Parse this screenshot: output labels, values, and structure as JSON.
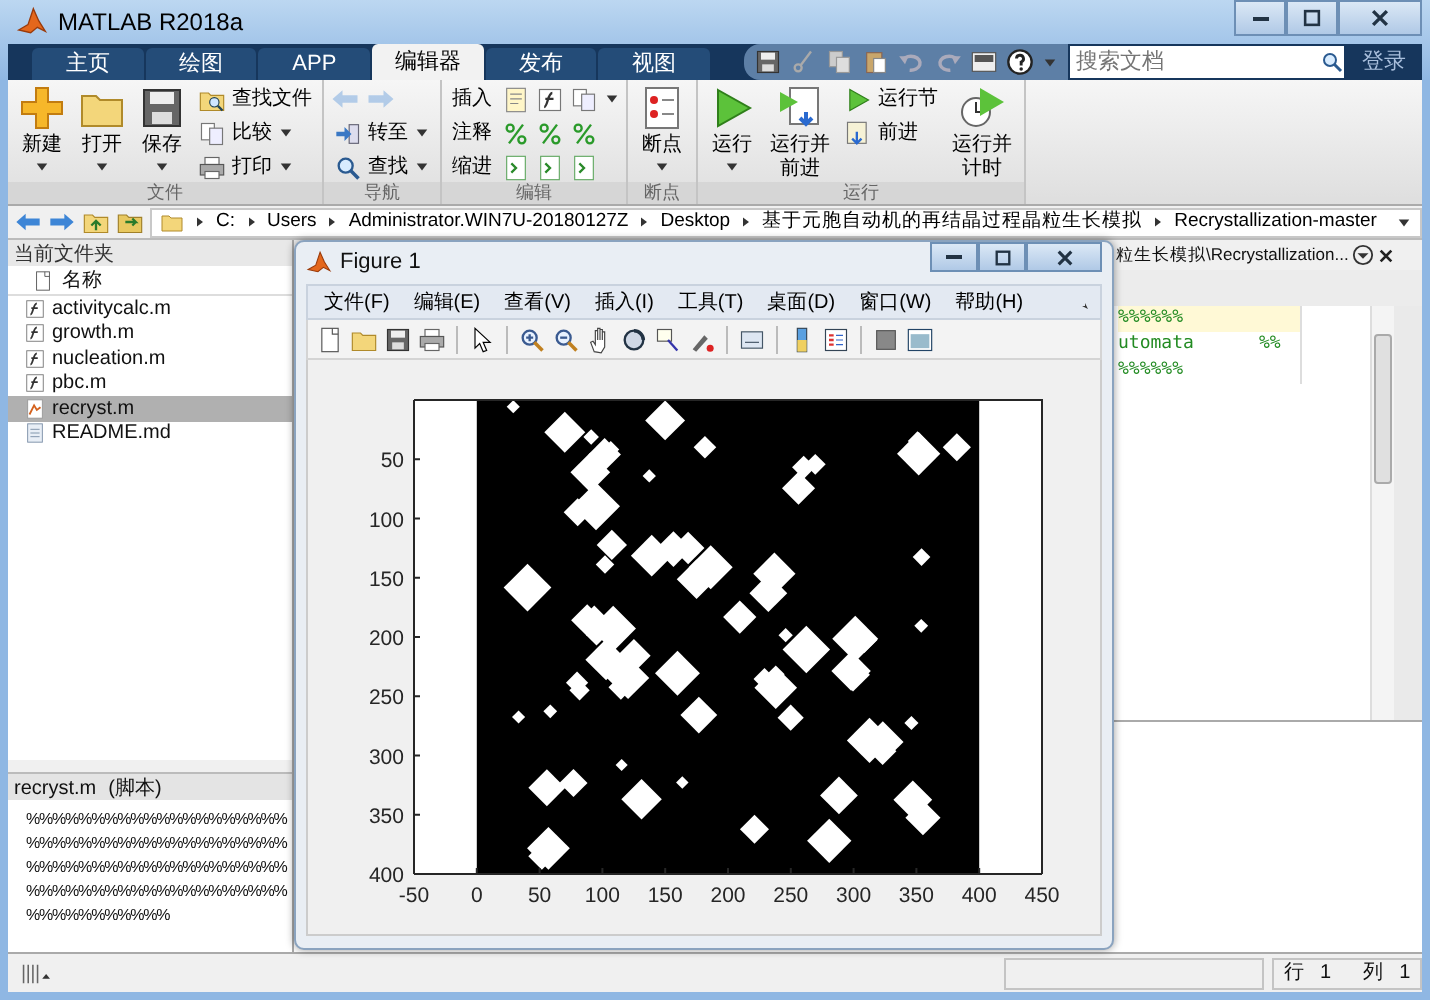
{
  "window": {
    "title": "MATLAB R2018a"
  },
  "tabs": [
    {
      "label": "主页",
      "selected": false
    },
    {
      "label": "绘图",
      "selected": false
    },
    {
      "label": "APP",
      "selected": false
    },
    {
      "label": "编辑器",
      "selected": true
    },
    {
      "label": "发布",
      "selected": false
    },
    {
      "label": "视图",
      "selected": false
    }
  ],
  "search": {
    "placeholder": "搜索文档"
  },
  "sign_in": "登录",
  "toolstrip": [
    {
      "label": "文件",
      "items": [
        {
          "kind": "large",
          "label": "新建",
          "dropdown": true
        },
        {
          "kind": "large",
          "label": "打开",
          "dropdown": true
        },
        {
          "kind": "large",
          "label": "保存",
          "dropdown": true
        },
        {
          "kind": "stack",
          "rows": [
            {
              "kind": "button",
              "label": "查找文件",
              "dropdown": false
            },
            {
              "kind": "button",
              "label": "比较",
              "dropdown": true
            },
            {
              "kind": "button",
              "label": "打印",
              "dropdown": true
            }
          ]
        }
      ]
    },
    {
      "label": "导航",
      "items": [
        {
          "kind": "stack",
          "rows": [
            {
              "kind": "arrows",
              "disabled": true
            },
            {
              "kind": "button",
              "label": "转至",
              "dropdown": true
            },
            {
              "kind": "button",
              "label": "查找",
              "dropdown": true
            }
          ]
        }
      ]
    },
    {
      "label": "编辑",
      "items": [
        {
          "kind": "stack",
          "rows": [
            {
              "kind": "tools",
              "label": "插入",
              "dropdown": true
            },
            {
              "kind": "tools",
              "label": "注释",
              "dropdown": false
            },
            {
              "kind": "tools",
              "label": "缩进",
              "dropdown": false
            }
          ]
        }
      ]
    },
    {
      "label": "断点",
      "items": [
        {
          "kind": "large",
          "label": "断点",
          "dropdown": true
        }
      ]
    },
    {
      "label": "运行",
      "items": [
        {
          "kind": "large",
          "label": "运行",
          "dropdown": true
        },
        {
          "kind": "large",
          "label": "运行并前进",
          "dropdown": false
        },
        {
          "kind": "stack",
          "rows": [
            {
              "kind": "button",
              "label": "运行节",
              "dropdown": false
            },
            {
              "kind": "button",
              "label": "前进",
              "dropdown": false
            }
          ]
        },
        {
          "kind": "large",
          "label": "运行并计时",
          "dropdown": false
        }
      ]
    }
  ],
  "address": {
    "segments": [
      "C:",
      "Users",
      "Administrator.WIN7U-20180127Z",
      "Desktop",
      "基于元胞自动机的再结晶过程晶粒生长模拟",
      "Recrystallization-master"
    ]
  },
  "current_folder": {
    "title": "当前文件夹",
    "column": "名称",
    "files": [
      {
        "name": "activitycalc.m",
        "kind": "function",
        "selected": false
      },
      {
        "name": "growth.m",
        "kind": "function",
        "selected": false
      },
      {
        "name": "nucleation.m",
        "kind": "function",
        "selected": false
      },
      {
        "name": "pbc.m",
        "kind": "function",
        "selected": false
      },
      {
        "name": "recryst.m",
        "kind": "script",
        "selected": true
      },
      {
        "name": "README.md",
        "kind": "document",
        "selected": false
      }
    ]
  },
  "details": {
    "file": "recryst.m",
    "type": "(脚本)",
    "lines": [
      "%%%%%%%%%%%%%%%%%%%%",
      "%%%%%%%%%%%%%%%%%%%%",
      "%%%%%%%%%%%%%%%%%%%%",
      "%%%%%%%%%%%%%%%%%%%%",
      "%%%%%%%%%%%"
    ]
  },
  "editor": {
    "tab_title": "粒生长模拟\\Recrystallization...",
    "lines": [
      {
        "text": "%%%%%%",
        "highlighted": true
      },
      {
        "text": "utomata      %%",
        "highlighted": false
      },
      {
        "text": "%%%%%%",
        "highlighted": false
      }
    ]
  },
  "figure": {
    "title": "Figure 1",
    "menus": [
      "文件(F)",
      "编辑(E)",
      "查看(V)",
      "插入(I)",
      "工具(T)",
      "桌面(D)",
      "窗口(W)",
      "帮助(H)"
    ],
    "xticks": [
      "-50",
      "0",
      "50",
      "100",
      "150",
      "200",
      "250",
      "300",
      "350",
      "400",
      "450"
    ],
    "yticks": [
      "50",
      "100",
      "150",
      "200",
      "250",
      "300",
      "350",
      "400"
    ]
  },
  "status_bar": {
    "row_label": "行",
    "row": "1",
    "col_label": "列",
    "col": "1"
  }
}
